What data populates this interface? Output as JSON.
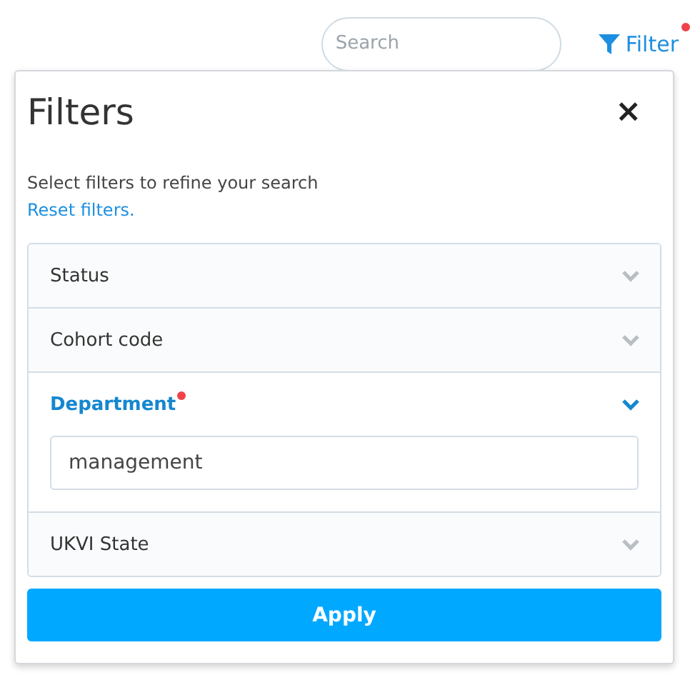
{
  "search": {
    "placeholder": "Search"
  },
  "filter_button": {
    "label": "Filter",
    "active": true
  },
  "panel": {
    "title": "Filters",
    "close": "×",
    "description": "Select filters to refine your search",
    "reset_link": "Reset filters.",
    "sections": [
      {
        "label": "Status",
        "expanded": false,
        "active": false
      },
      {
        "label": "Cohort code",
        "expanded": false,
        "active": false
      },
      {
        "label": "Department",
        "expanded": true,
        "active": true,
        "value": "management"
      },
      {
        "label": "UKVI State",
        "expanded": false,
        "active": false
      }
    ],
    "apply_button": "Apply"
  }
}
